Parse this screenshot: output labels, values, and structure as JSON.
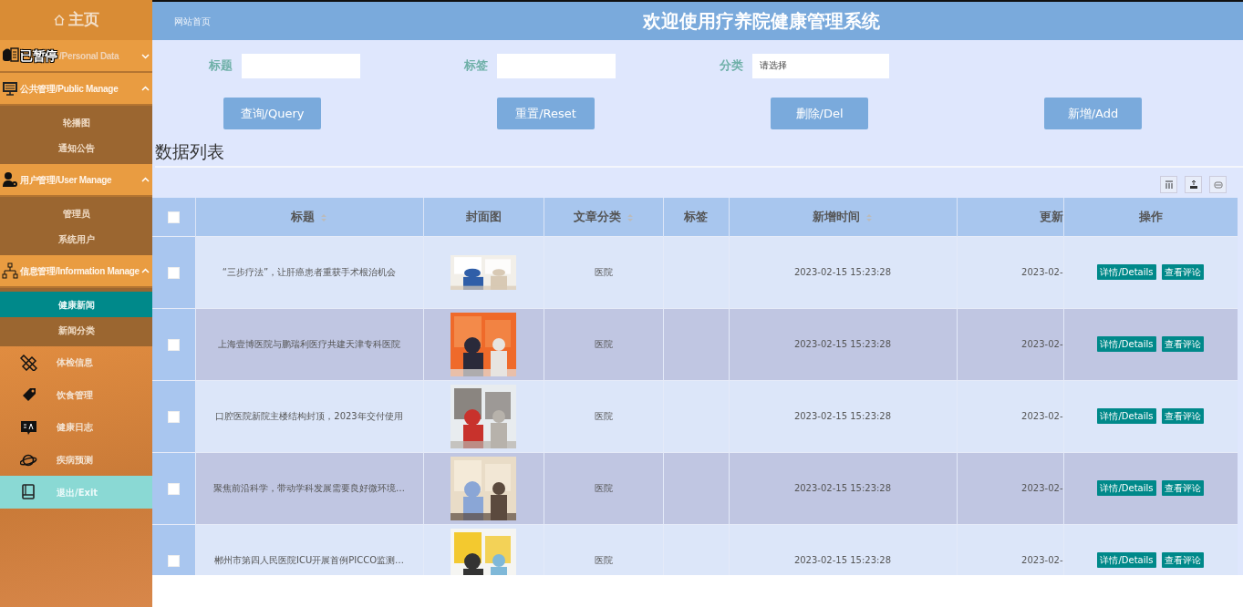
{
  "sidebar": {
    "home": "主页",
    "groups": [
      {
        "label": "/Personal Data",
        "overlay_text": "已暂停",
        "expanded": false
      },
      {
        "label": "公共管理/Public Manage",
        "expanded": true,
        "children": [
          {
            "label": "轮播图",
            "selected": false
          },
          {
            "label": "通知公告",
            "selected": false
          }
        ]
      },
      {
        "label": "用户管理/User Manage",
        "expanded": true,
        "children": [
          {
            "label": "管理员",
            "selected": false
          },
          {
            "label": "系统用户",
            "selected": false
          }
        ]
      },
      {
        "label": "信息管理/Information Manage",
        "expanded": true,
        "children": [
          {
            "label": "健康新闻",
            "selected": true
          },
          {
            "label": "新闻分类",
            "selected": false
          }
        ]
      }
    ],
    "items": [
      {
        "label": "体检信息",
        "highlighted": false
      },
      {
        "label": "饮食管理",
        "highlighted": false
      },
      {
        "label": "健康日志",
        "highlighted": false
      },
      {
        "label": "疾病预测",
        "highlighted": false
      },
      {
        "label": "退出/Exit",
        "highlighted": true
      }
    ]
  },
  "header": {
    "home_link": "网站首页",
    "title": "欢迎使用疗养院健康管理系统"
  },
  "filters": [
    {
      "label": "标题",
      "kind": "input"
    },
    {
      "label": "标签",
      "kind": "input"
    },
    {
      "label": "分类",
      "kind": "select",
      "placeholder": "请选择"
    }
  ],
  "buttons": [
    "查询/Query",
    "重置/Reset",
    "删除/Del",
    "新增/Add"
  ],
  "list_title": "数据列表",
  "table": {
    "select_all_checked": false,
    "columns": [
      {
        "label": "标题",
        "sortable": true
      },
      {
        "label": "封面图",
        "sortable": false
      },
      {
        "label": "文章分类",
        "sortable": true
      },
      {
        "label": "标签",
        "sortable": false
      },
      {
        "label": "新增时间",
        "sortable": true
      },
      {
        "label": "更新",
        "sortable": false
      },
      {
        "label": "操作",
        "sortable": false
      }
    ],
    "rows": [
      {
        "title": "“三步疗法”，让肝癌患者重获手术根治机会",
        "checked": false,
        "cover": {
          "kind": "picture"
        },
        "category": "医院",
        "added": "2023-02-15 15:23:28",
        "updated": "2023-02-",
        "actions": [
          "详情/Details",
          "查看评论"
        ]
      },
      {
        "title": "上海壹博医院与鹏瑞利医疗共建天津专科医院",
        "checked": false,
        "cover": {
          "kind": "picture"
        },
        "category": "医院",
        "added": "2023-02-15 15:23:28",
        "updated": "2023-02-",
        "actions": [
          "详情/Details",
          "查看评论"
        ]
      },
      {
        "title": "口腔医院新院主楼结构封顶，2023年交付使用",
        "checked": false,
        "cover": {
          "kind": "picture"
        },
        "category": "医院",
        "added": "2023-02-15 15:23:28",
        "updated": "2023-02-",
        "actions": [
          "详情/Details",
          "查看评论"
        ]
      },
      {
        "title": "聚焦前沿科学，带动学科发展需要良好微环境…",
        "checked": false,
        "cover": {
          "kind": "picture"
        },
        "category": "医院",
        "added": "2023-02-15 15:23:28",
        "updated": "2023-02-",
        "actions": [
          "详情/Details",
          "查看评论"
        ]
      },
      {
        "title": "郴州市第四人民医院ICU开展首例PICCO监测…",
        "checked": false,
        "cover": {
          "kind": "picture"
        },
        "category": "医院",
        "added": "2023-02-15 15:23:28",
        "updated": "2023-02-",
        "actions": [
          "详情/Details",
          "查看评论"
        ]
      }
    ]
  }
}
